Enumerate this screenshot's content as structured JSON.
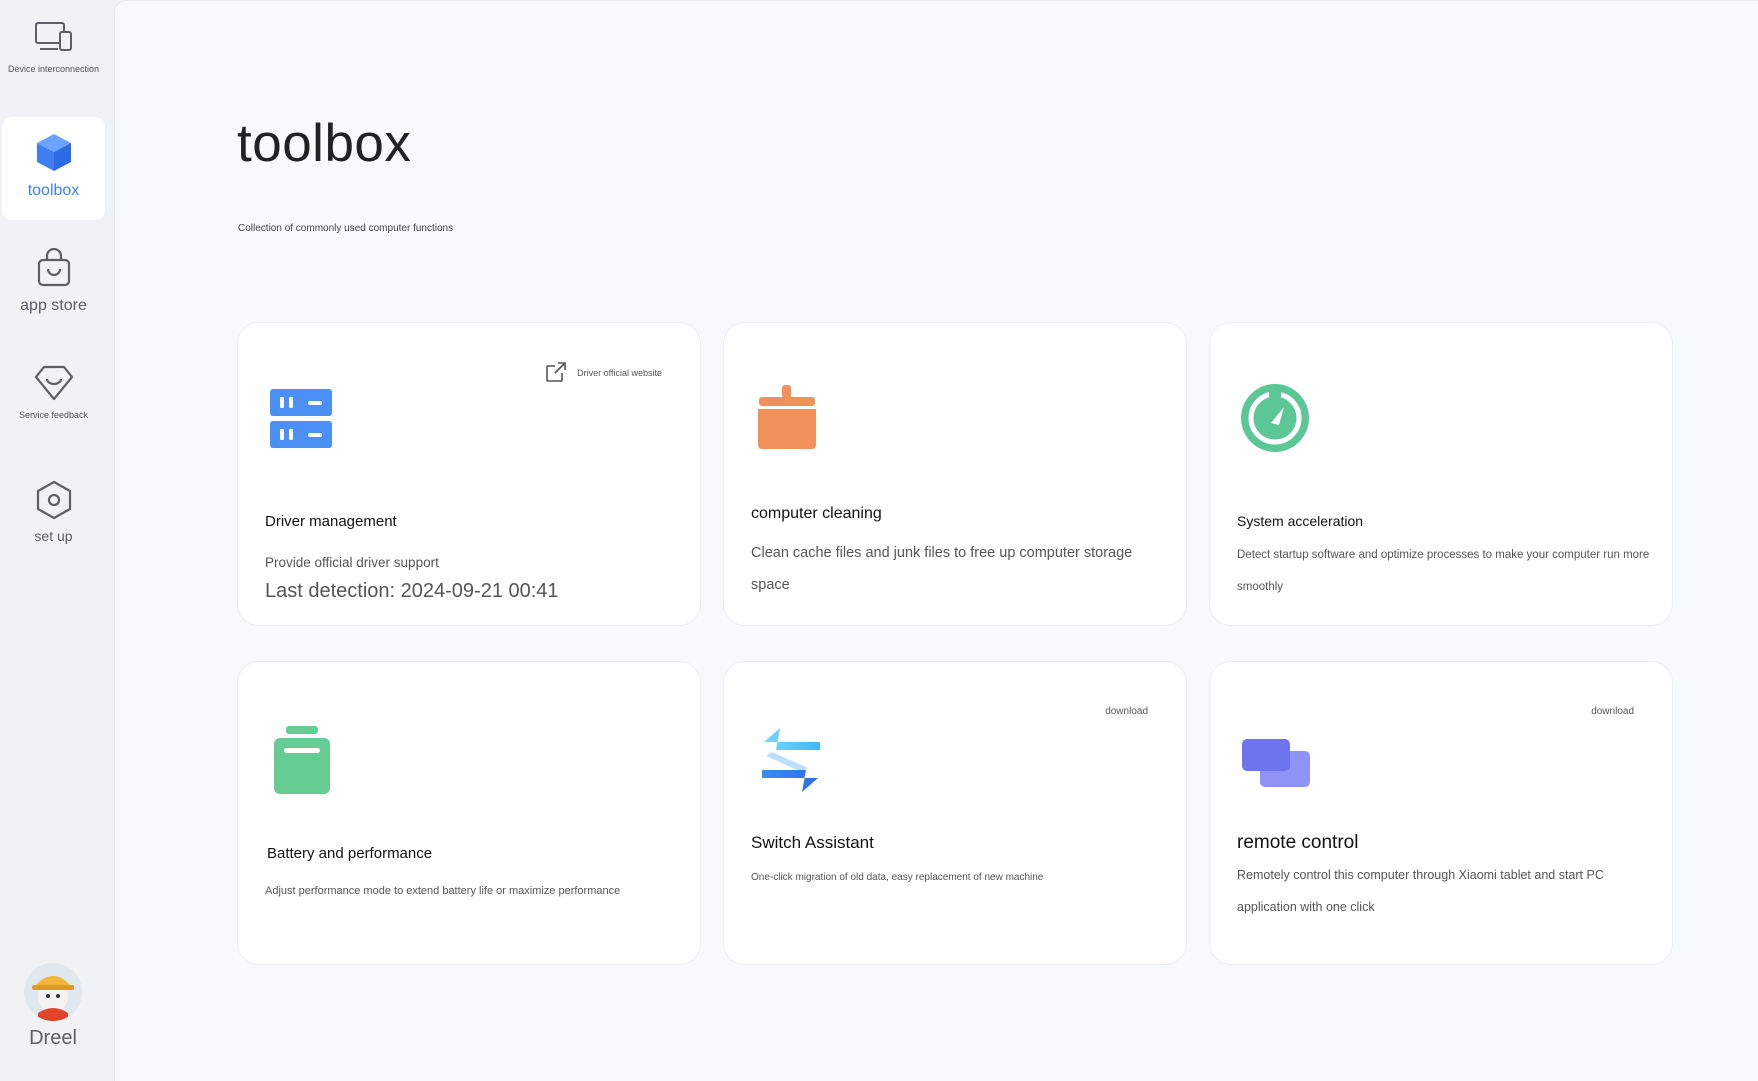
{
  "sidebar": {
    "items": [
      {
        "label": "Device interconnection",
        "icon": "devices-icon"
      },
      {
        "label": "toolbox",
        "icon": "cube-icon",
        "active": true
      },
      {
        "label": "app store",
        "icon": "shopping-bag-icon"
      },
      {
        "label": "Service feedback",
        "icon": "heart-feedback-icon"
      },
      {
        "label": "set up",
        "icon": "settings-hexagon-icon"
      }
    ],
    "user": {
      "name": "Dreel"
    }
  },
  "page": {
    "title": "toolbox",
    "subtitle": "Collection of commonly used computer functions"
  },
  "cards": [
    {
      "title": "Driver management",
      "description": "Provide official driver support",
      "extra": "Last detection: 2024-09-21 00:41",
      "link": "Driver official website",
      "icon": "server-icon",
      "color": "#4a90f5"
    },
    {
      "title": "computer cleaning",
      "description": "Clean cache files and junk files to free up computer storage space",
      "icon": "broom-icon",
      "color": "#f0905a"
    },
    {
      "title": "System acceleration",
      "description": "Detect startup software and optimize processes to make your computer run more smoothly",
      "icon": "speedometer-icon",
      "color": "#5cc796"
    },
    {
      "title": "Battery and performance",
      "description": "Adjust performance mode to extend battery life or maximize performance",
      "icon": "battery-icon",
      "color": "#66cc94"
    },
    {
      "title": "Switch Assistant",
      "description": "One-click migration of old data, easy replacement of new machine",
      "link": "download",
      "icon": "switch-arrows-icon",
      "color": "#4a90f5"
    },
    {
      "title": "remote control",
      "description": "Remotely control this computer through Xiaomi tablet and start PC application with one click",
      "link": "download",
      "icon": "remote-screens-icon",
      "color": "#7b7ff0"
    }
  ]
}
